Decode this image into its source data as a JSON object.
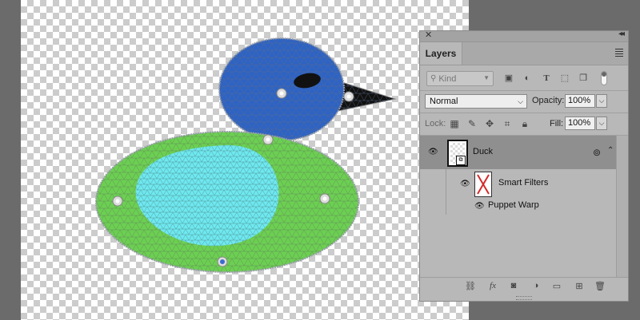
{
  "panel": {
    "title": "Layers",
    "filter": {
      "kind_placeholder": "Kind",
      "icons": [
        "image-filter-icon",
        "adjustment-filter-icon",
        "type-filter-icon",
        "shape-filter-icon",
        "smart-object-filter-icon"
      ]
    },
    "blend_mode": "Normal",
    "opacity_label": "Opacity:",
    "opacity_value": "100%",
    "lock_label": "Lock:",
    "fill_label": "Fill:",
    "fill_value": "100%",
    "layers": [
      {
        "name": "Duck",
        "visible": true,
        "type": "smart-object",
        "smart_filters": {
          "label": "Smart Filters",
          "filters": [
            "Puppet Warp"
          ]
        }
      }
    ],
    "bottom_icons": [
      "link-icon",
      "fx-icon",
      "mask-icon",
      "adjustment-icon",
      "folder-icon",
      "new-layer-icon",
      "trash-icon"
    ]
  },
  "colors": {
    "head": "#2e63c4",
    "body": "#6ccf52",
    "wing": "#6fe8ef",
    "beak": "#111111",
    "mesh": "#8a8a8a",
    "workspace": "#6b6b6b",
    "panel": "#b8b8b8",
    "selected_layer": "#8f8f8f"
  },
  "puppet_pins": 6
}
